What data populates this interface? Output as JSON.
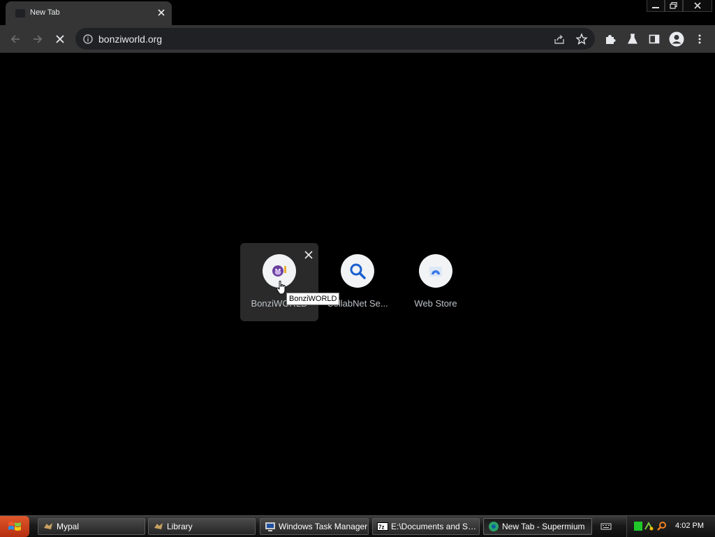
{
  "browser": {
    "tab": {
      "title": "New Tab"
    },
    "address_bar": {
      "url": "bonziworld.org"
    }
  },
  "new_tab_page": {
    "shortcuts": [
      {
        "label": "BonziWORLD",
        "icon": "bonzi-purple-gorilla-icon",
        "hovered": true
      },
      {
        "label": "CollabNet Se...",
        "icon": "magnifier-search-icon"
      },
      {
        "label": "Web Store",
        "icon": "web-store-icon"
      }
    ],
    "tooltip": "BonziWORLD"
  },
  "taskbar": {
    "items": [
      {
        "label": "Mypal",
        "icon": "mypal-icon"
      },
      {
        "label": "Library",
        "icon": "library-icon"
      },
      {
        "label": "Windows Task Manager",
        "icon": "task-manager-icon"
      },
      {
        "label": "E:\\Documents and Set...",
        "icon": "7zip-icon"
      },
      {
        "label": "New Tab - Supermium",
        "icon": "supermium-icon",
        "active": true
      }
    ],
    "clock": "4:02 PM"
  },
  "colors": {
    "page_background": "#000000",
    "toolbar": "#353535",
    "omnibox": "#202124",
    "start_button": "#c83c1a"
  }
}
